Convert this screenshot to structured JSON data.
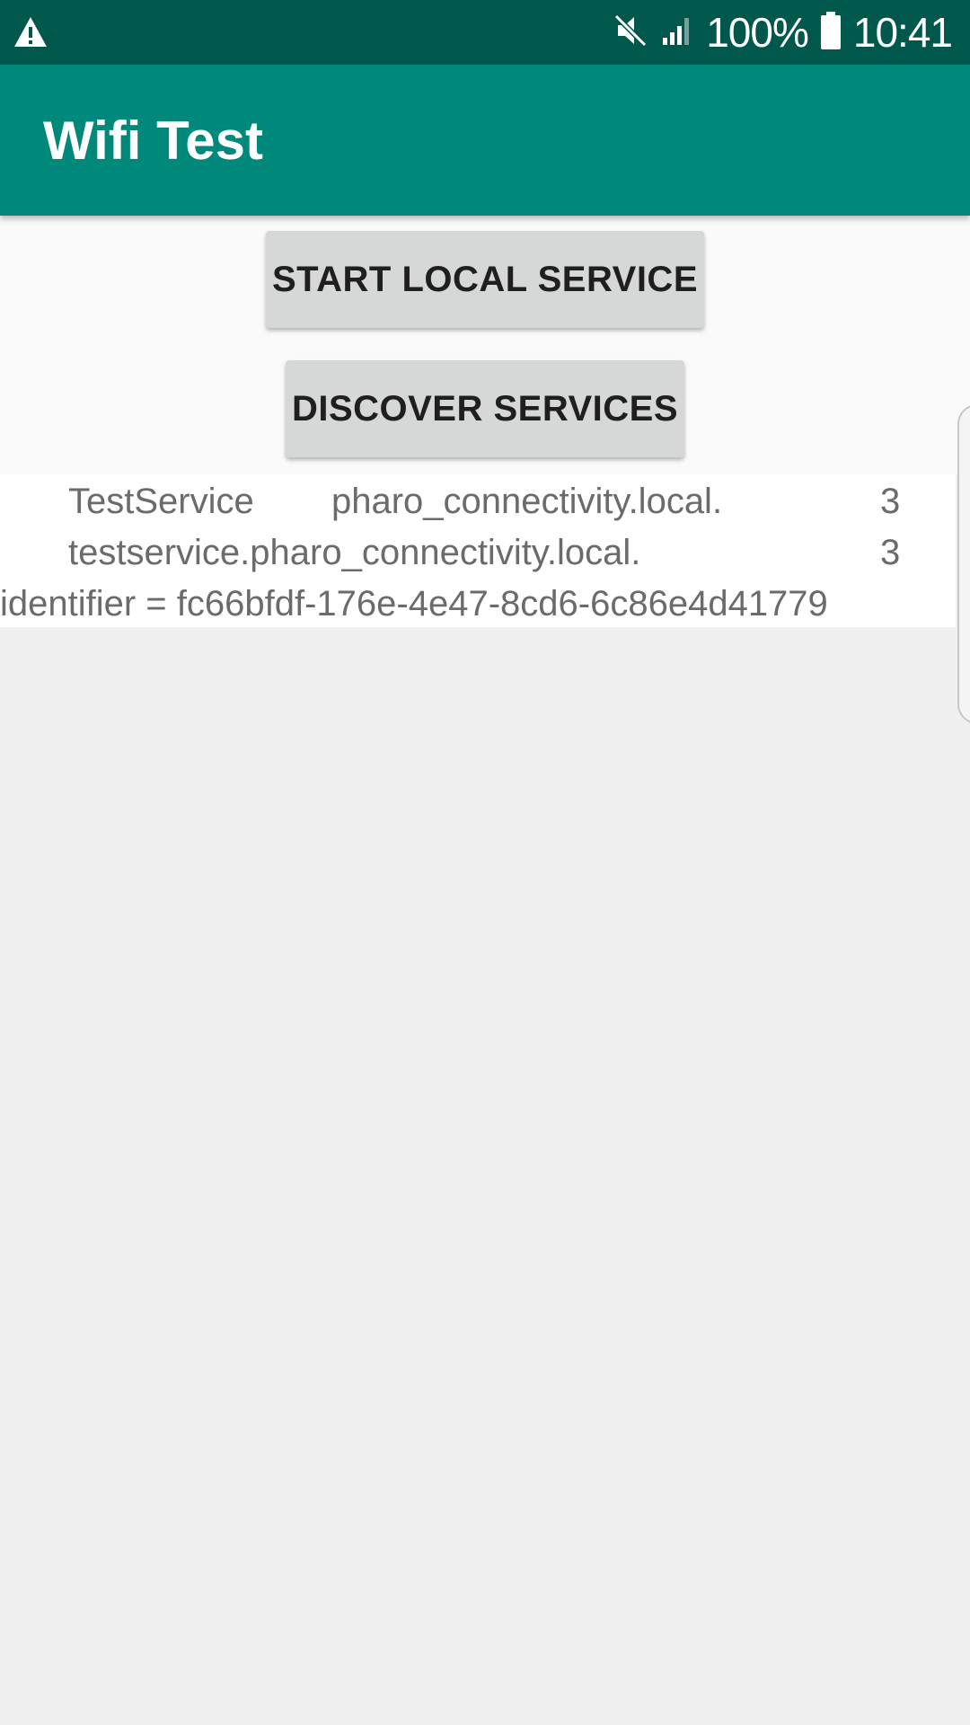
{
  "status_bar": {
    "battery_percent": "100%",
    "time": "10:41",
    "icons": [
      "warning-icon",
      "mute-icon",
      "signal-icon",
      "battery-icon"
    ]
  },
  "app_bar": {
    "title": "Wifi Test"
  },
  "buttons": {
    "start_local_service": "START LOCAL SERVICE",
    "discover_services": "DISCOVER SERVICES"
  },
  "results": {
    "row1": {
      "name": "TestService",
      "host": "pharo_connectivity.local.",
      "count": "3"
    },
    "row2": {
      "host": "testservice.pharo_connectivity.local.",
      "count": "3"
    },
    "row3": {
      "identifier": "identifier = fc66bfdf-176e-4e47-8cd6-6c86e4d41779"
    }
  },
  "colors": {
    "status_bar": "#00574b",
    "app_bar": "#00897b",
    "button": "#d6d7d7",
    "background": "#f0f0f0"
  }
}
